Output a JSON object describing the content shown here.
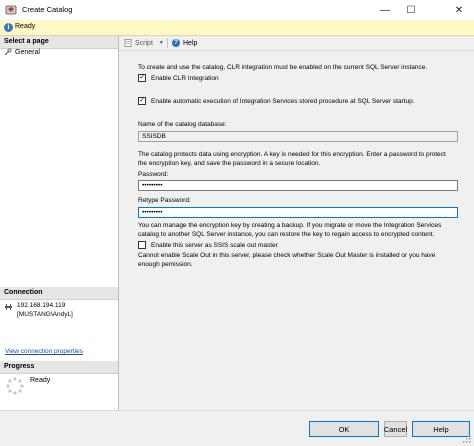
{
  "window": {
    "title": "Create Catalog"
  },
  "status_bar": {
    "text": "Ready"
  },
  "left_pane": {
    "select_page_header": "Select a page",
    "pages": [
      {
        "label": "General"
      }
    ],
    "connection_header": "Connection",
    "connection": {
      "server": "192.168.194.119",
      "user": "[MUSTANG\\AndyL]"
    },
    "view_connection_link": "View connection properties",
    "progress_header": "Progress",
    "progress_status": "Ready"
  },
  "toolbar": {
    "script_label": "Script",
    "help_label": "Help"
  },
  "form": {
    "clr_note": "To create and use the catalog, CLR integration must be enabled on the current SQL Server instance.",
    "enable_clr": {
      "label": "Enable CLR Integration",
      "checked": true
    },
    "auto_exec": {
      "label": "Enable automatic execution of Integration Services stored procedure at SQL Server startup.",
      "checked": true
    },
    "catalog_name_label": "Name of the catalog database:",
    "catalog_name_value": "SSISDB",
    "encryption_note_1": "The catalog protects data using encryption. A key is needed for this encryption. Enter a password to protect",
    "encryption_note_2": "the encryption key, and save the password in a secure location.",
    "password_label": "Password:",
    "password_value": "•••••••••",
    "retype_label": "Retype Password:",
    "retype_value": "•••••••••",
    "backup_note_1": "You can manage the encryption key by creating a backup. If you migrate or move the Integration Services",
    "backup_note_2": "catalog to another SQL Server instance, you can restore the key to regain access to encrypted content.",
    "scale_out": {
      "label": "Enable this server as SSIS scale out master",
      "checked": false
    },
    "scale_out_note_1": "Cannot enable Scale Out in this server, please check whether Scale Out Master is installed or you have",
    "scale_out_note_2": "enough pemission."
  },
  "buttons": {
    "ok": "OK",
    "cancel": "Cancel",
    "help": "Help"
  },
  "colors": {
    "status_bar_bg": "#fff8c4",
    "link": "#1a4fb4",
    "focus_border": "#0078d7"
  }
}
